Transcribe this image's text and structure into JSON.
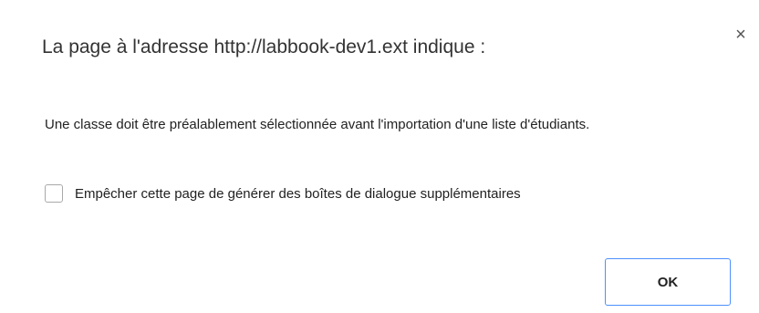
{
  "dialog": {
    "title": "La page à l'adresse http://labbook-dev1.ext indique :",
    "close_glyph": "×",
    "message": "Une classe doit être préalablement sélectionnée avant l'importation d'une liste d'étudiants.",
    "suppress_checkbox": {
      "label": "Empêcher cette page de générer des boîtes de dialogue supplémentaires",
      "checked": false
    },
    "ok_label": "OK",
    "accent_color": "#4d90fe"
  }
}
